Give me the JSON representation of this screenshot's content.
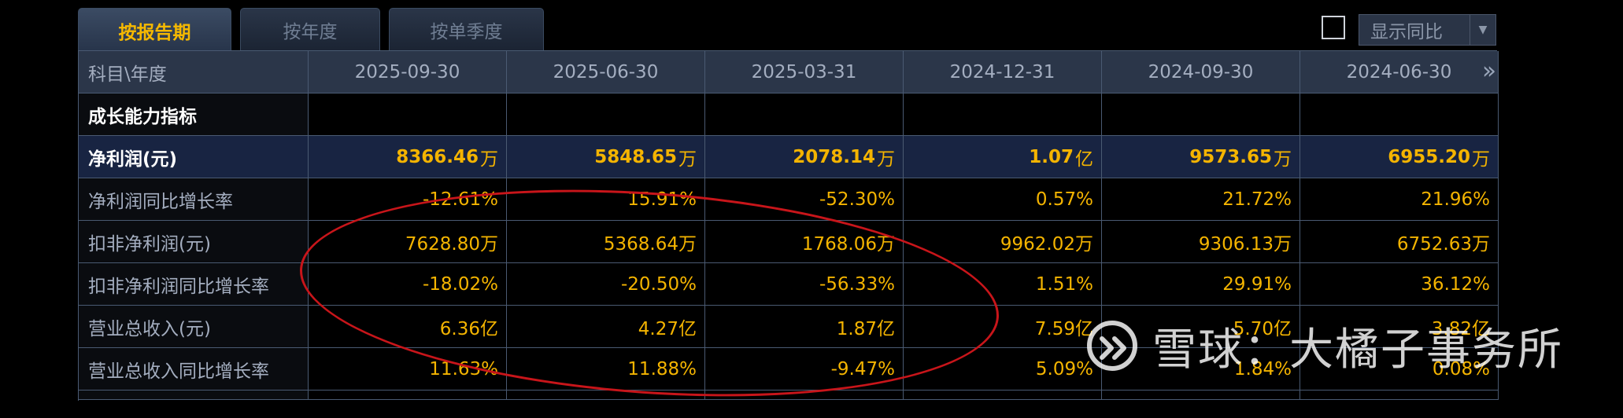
{
  "tabs": [
    {
      "label": "按报告期"
    },
    {
      "label": "按年度"
    },
    {
      "label": "按单季度"
    }
  ],
  "toggle": {
    "label": "显示同比"
  },
  "table": {
    "corner_label": "科目\\年度",
    "dates": [
      "2025-09-30",
      "2025-06-30",
      "2025-03-31",
      "2024-12-31",
      "2024-09-30",
      "2024-06-30"
    ],
    "section_label": "成长能力指标",
    "net_profit": {
      "label": "净利润(元)",
      "values": [
        {
          "num": "8366.46",
          "unit": "万"
        },
        {
          "num": "5848.65",
          "unit": "万"
        },
        {
          "num": "2078.14",
          "unit": "万"
        },
        {
          "num": "1.07",
          "unit": "亿"
        },
        {
          "num": "9573.65",
          "unit": "万"
        },
        {
          "num": "6955.20",
          "unit": "万"
        }
      ]
    },
    "rows": [
      {
        "label": "净利润同比增长率",
        "values": [
          "-12.61%",
          "15.91%",
          "-52.30%",
          "0.57%",
          "21.72%",
          "21.96%"
        ]
      },
      {
        "label": "扣非净利润(元)",
        "values": [
          "7628.80万",
          "5368.64万",
          "1768.06万",
          "9962.02万",
          "9306.13万",
          "6752.63万"
        ]
      },
      {
        "label": "扣非净利润同比增长率",
        "values": [
          "-18.02%",
          "-20.50%",
          "-56.33%",
          "1.51%",
          "29.91%",
          "36.12%"
        ]
      },
      {
        "label": "营业总收入(元)",
        "values": [
          "6.36亿",
          "4.27亿",
          "1.87亿",
          "7.59亿",
          "5.70亿",
          "3.82亿"
        ]
      },
      {
        "label": "营业总收入同比增长率",
        "values": [
          "11.63%",
          "11.88%",
          "-9.47%",
          "5.09%",
          "1.84%",
          "0.08%"
        ]
      }
    ]
  },
  "watermark": {
    "text": "雪球：大橘子事务所"
  },
  "colors": {
    "accent": "#f4b400",
    "header_bg": "#2b3649",
    "highlight_row_bg": "#182442",
    "annotation": "#c8151a"
  }
}
